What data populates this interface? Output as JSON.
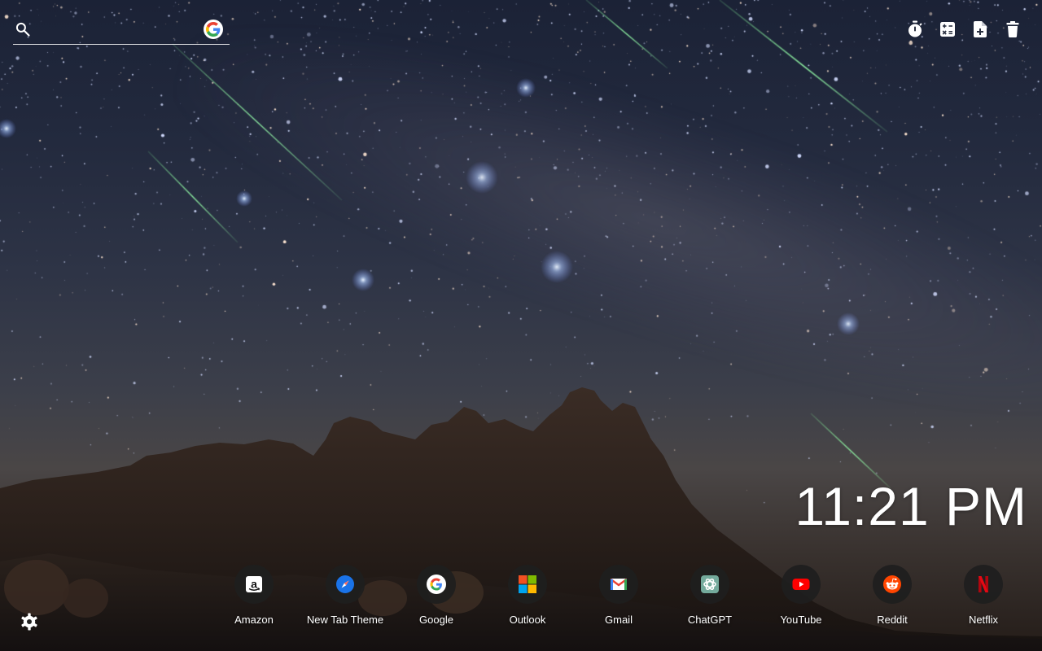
{
  "search": {
    "placeholder": "",
    "value": "",
    "search_icon": "search-icon",
    "engine_icon": "google-g-icon"
  },
  "tools": [
    {
      "name": "timer",
      "icon": "stopwatch-icon"
    },
    {
      "name": "calculator",
      "icon": "calculator-icon"
    },
    {
      "name": "new-note",
      "icon": "note-add-icon"
    },
    {
      "name": "delete",
      "icon": "trash-icon"
    }
  ],
  "clock": {
    "time": "11:21 PM"
  },
  "shortcuts": [
    {
      "label": "Amazon",
      "icon": "amazon-icon"
    },
    {
      "label": "New Tab Theme",
      "icon": "compass-icon"
    },
    {
      "label": "Google",
      "icon": "google-g-icon"
    },
    {
      "label": "Outlook",
      "icon": "microsoft-icon"
    },
    {
      "label": "Gmail",
      "icon": "gmail-icon"
    },
    {
      "label": "ChatGPT",
      "icon": "chatgpt-icon"
    },
    {
      "label": "YouTube",
      "icon": "youtube-icon"
    },
    {
      "label": "Reddit",
      "icon": "reddit-icon"
    },
    {
      "label": "Netflix",
      "icon": "netflix-icon"
    }
  ],
  "settings": {
    "icon": "gear-icon"
  },
  "colors": {
    "google_blue": "#4285F4",
    "google_red": "#EA4335",
    "google_yellow": "#FBBC05",
    "google_green": "#34A853",
    "youtube_red": "#FF0000",
    "reddit_orange": "#FF4500",
    "netflix_red": "#E50914",
    "chatgpt_teal": "#74AA9C"
  }
}
